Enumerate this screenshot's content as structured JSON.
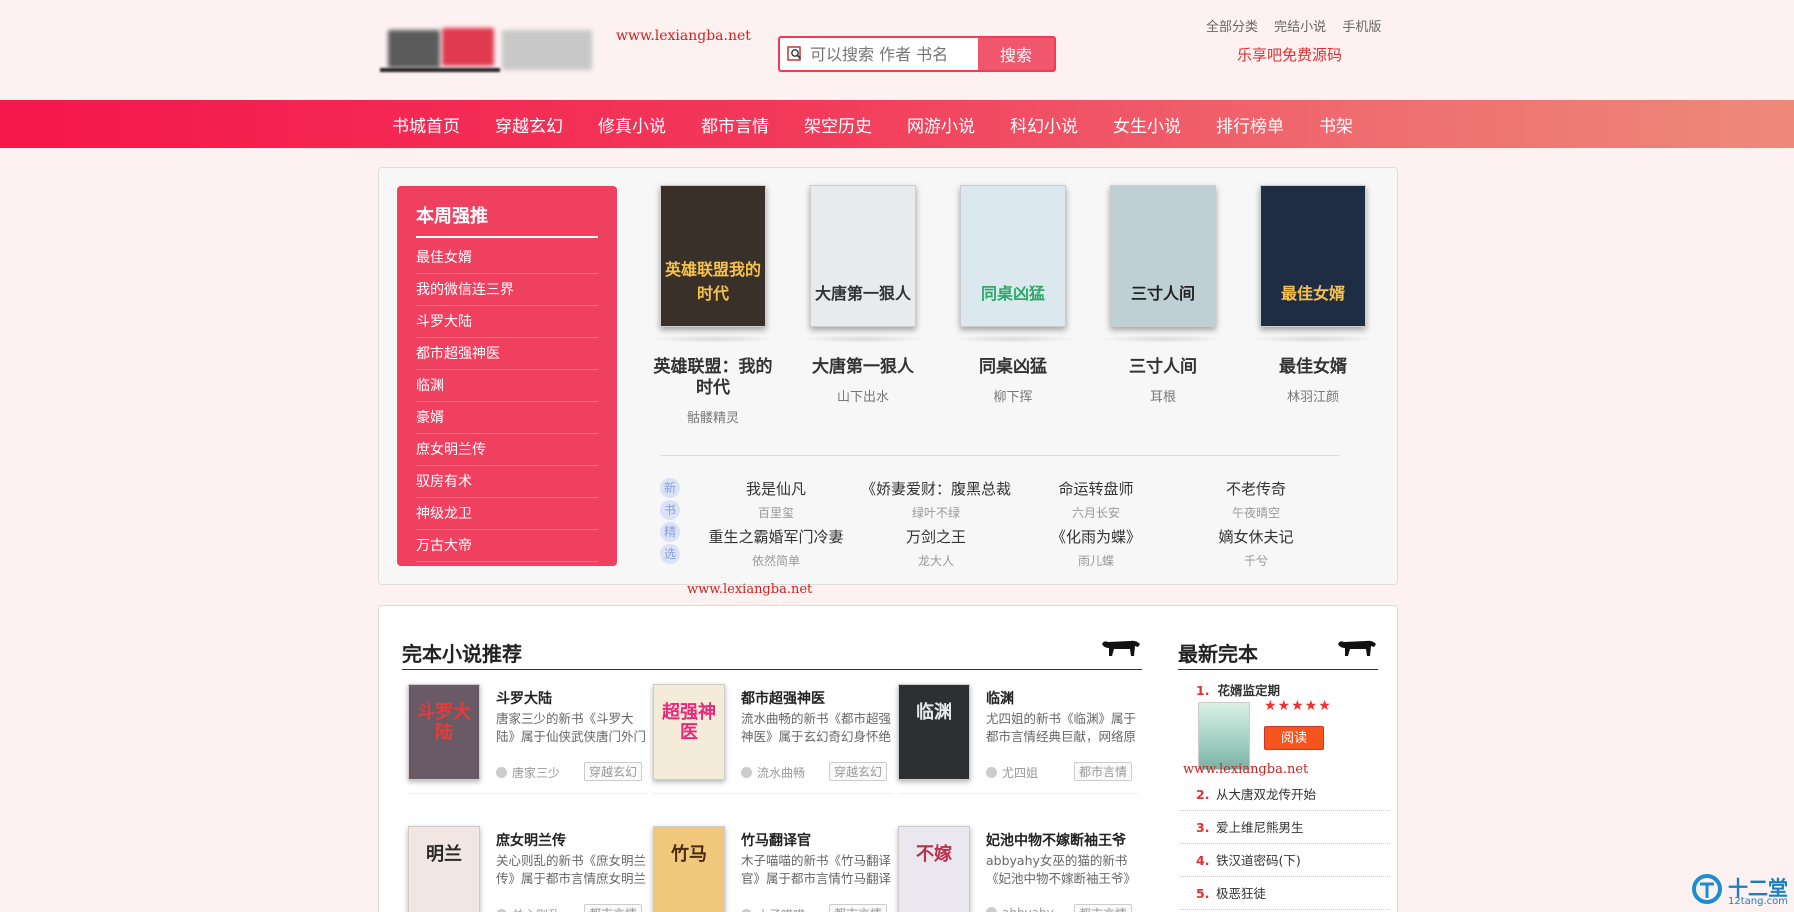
{
  "header": {
    "watermark": "www.lexiangba.net",
    "search_placeholder": "可以搜索 作者 书名",
    "search_button": "搜索",
    "top_links": [
      "全部分类",
      "完结小说",
      "手机版"
    ],
    "source_link": "乐享吧免费源码"
  },
  "nav": [
    "书城首页",
    "穿越玄幻",
    "修真小说",
    "都市言情",
    "架空历史",
    "网游小说",
    "科幻小说",
    "女生小说",
    "排行榜单",
    "书架"
  ],
  "weekly": {
    "title": "本周强推",
    "items": [
      "最佳女婿",
      "我的微信连三界",
      "斗罗大陆",
      "都市超强神医",
      "临渊",
      "豪婿",
      "庶女明兰传",
      "驭房有术",
      "神级龙卫",
      "万古大帝"
    ]
  },
  "featured": [
    {
      "title": "英雄联盟：我的时代",
      "author": "骷髅精灵",
      "cover_text": "英雄联盟我的时代",
      "bg": "#3a302a",
      "fg": "#f5c14a"
    },
    {
      "title": "大唐第一狠人",
      "author": "山下出水",
      "cover_text": "大唐第一狠人",
      "bg": "#e8eaec",
      "fg": "#333333"
    },
    {
      "title": "同桌凶猛",
      "author": "柳下挥",
      "cover_text": "同桌凶猛",
      "bg": "#dbe9ee",
      "fg": "#2ea86a"
    },
    {
      "title": "三寸人间",
      "author": "耳根",
      "cover_text": "三寸人间",
      "bg": "#bfd0d4",
      "fg": "#222222"
    },
    {
      "title": "最佳女婿",
      "author": "林羽江颜",
      "cover_text": "最佳女婿",
      "bg": "#1f2d44",
      "fg": "#f5c14a"
    }
  ],
  "new_picks_tag": [
    "新",
    "书",
    "精",
    "选"
  ],
  "new_picks": [
    {
      "title": "我是仙凡",
      "author": "百里玺"
    },
    {
      "title": "《娇妻爱财：腹黑总裁",
      "author": "绿叶不绿"
    },
    {
      "title": "命运转盘师",
      "author": "六月长安"
    },
    {
      "title": "不老传奇",
      "author": "午夜晴空"
    },
    {
      "title": "重生之霸婚军门冷妻",
      "author": "依然简单"
    },
    {
      "title": "万剑之王",
      "author": "龙大人"
    },
    {
      "title": "《化雨为蝶》",
      "author": "雨儿蝶"
    },
    {
      "title": "嫡女休夫记",
      "author": "千兮"
    }
  ],
  "mid_watermark": "www.lexiangba.net",
  "complete_section": {
    "title": "完本小说推荐",
    "books": [
      {
        "title": "斗罗大陆",
        "desc": "唐家三少的新书《斗罗大陆》属于仙侠武侠唐门外门",
        "author": "唐家三少",
        "genre": "穿越玄幻",
        "cover_text": "斗罗大陆",
        "bg": "#6a5a66",
        "fg": "#e83a3a"
      },
      {
        "title": "都市超强神医",
        "desc": "流水曲畅的新书《都市超强神医》属于玄幻奇幻身怀绝",
        "author": "流水曲畅",
        "genre": "穿越玄幻",
        "cover_text": "超强神医",
        "bg": "#f4ecd8",
        "fg": "#e8287a"
      },
      {
        "title": "临渊",
        "desc": "尤四姐的新书《临渊》属于都市言情经典巨献，网络原",
        "author": "尤四姐",
        "genre": "都市言情",
        "cover_text": "临渊",
        "bg": "#2c3032",
        "fg": "#e9e9e9"
      },
      {
        "title": "庶女明兰传",
        "desc": "关心则乱的新书《庶女明兰传》属于都市言情庶女明兰",
        "author": "关心则乱",
        "genre": "都市言情",
        "cover_text": "明兰",
        "bg": "#f1e6e2",
        "fg": "#2a2a2a"
      },
      {
        "title": "竹马翻译官",
        "desc": "木子喵喵的新书《竹马翻译官》属于都市言情竹马翻译",
        "author": "木子喵喵",
        "genre": "都市言情",
        "cover_text": "竹马",
        "bg": "#f1c77b",
        "fg": "#4a2a10"
      },
      {
        "title": "妃池中物不嫁断袖王爷",
        "desc": "abbyahy女巫的猫的新书《妃池中物不嫁断袖王爷》",
        "author": "abbyahy",
        "genre": "都市言情",
        "cover_text": "不嫁",
        "bg": "#eae8ee",
        "fg": "#b82e4e"
      }
    ]
  },
  "latest_section": {
    "title": "最新完本",
    "first": {
      "rank": "1.",
      "title": "花婿监定期",
      "stars": "★★★★★",
      "read": "阅读"
    },
    "items": [
      {
        "rank": "2.",
        "title": "从大唐双龙传开始"
      },
      {
        "rank": "3.",
        "title": "爱上维尼熊男生"
      },
      {
        "rank": "4.",
        "title": "铁汉道密码(下)"
      },
      {
        "rank": "5.",
        "title": "极恶狂徒"
      }
    ],
    "watermark": "www.lexiangba.net"
  },
  "corner_logo": {
    "text": "十二堂",
    "sub": "12tang.com"
  }
}
